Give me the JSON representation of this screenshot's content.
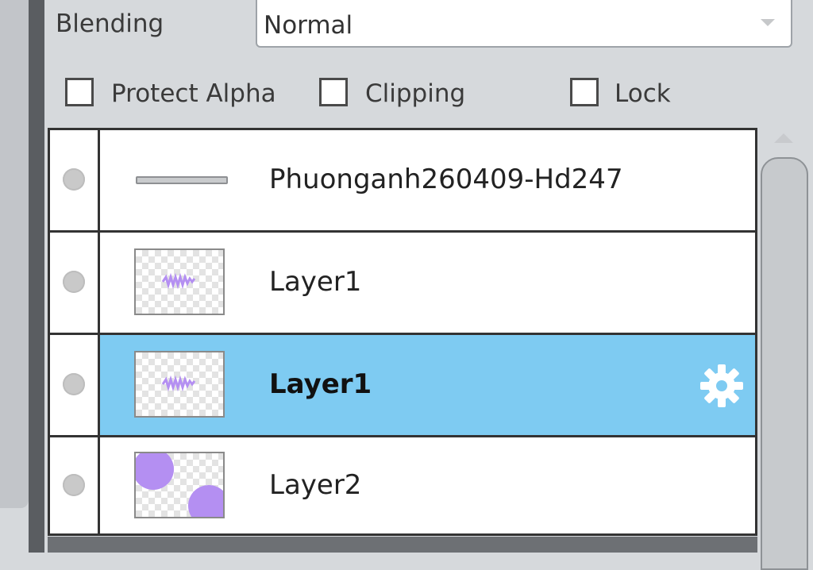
{
  "blending": {
    "label": "Blending",
    "value": "Normal"
  },
  "options": [
    {
      "label": "Protect Alpha",
      "checked": false
    },
    {
      "label": "Clipping",
      "checked": false
    },
    {
      "label": "Lock",
      "checked": false
    }
  ],
  "layers": [
    {
      "name": "Phuonganh260409-Hd247",
      "type": "folder",
      "selected": false
    },
    {
      "name": "Layer1",
      "type": "layer",
      "selected": false
    },
    {
      "name": "Layer1",
      "type": "layer",
      "selected": true
    },
    {
      "name": "Layer2",
      "type": "layer",
      "selected": false
    }
  ],
  "colors": {
    "selection": "#7ecbf2",
    "thumb_accent": "#b48ff2"
  }
}
